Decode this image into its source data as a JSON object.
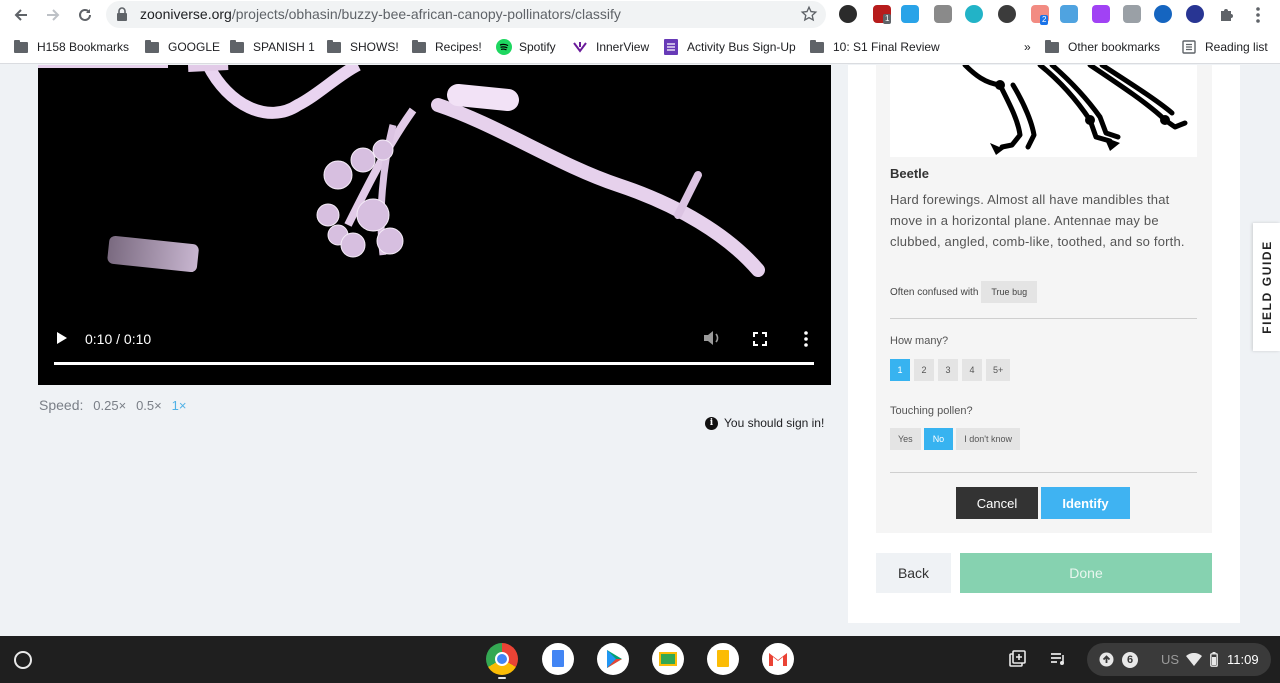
{
  "browser": {
    "url_host": "zooniverse.org",
    "url_path": "/projects/obhasin/buzzy-bee-african-canopy-pollinators/classify",
    "extension_badges": [
      "1",
      "2"
    ]
  },
  "bookmarks": {
    "items": [
      {
        "label": "H158 Bookmarks",
        "icon": "bookmark-folder-icon"
      },
      {
        "label": "GOOGLE",
        "icon": "folder-icon"
      },
      {
        "label": "SPANISH 1",
        "icon": "folder-icon"
      },
      {
        "label": "SHOWS!",
        "icon": "folder-icon"
      },
      {
        "label": "Recipes!",
        "icon": "folder-icon"
      },
      {
        "label": "Spotify",
        "icon": "spotify-icon"
      },
      {
        "label": "InnerView",
        "icon": "innerview-icon"
      },
      {
        "label": "Activity Bus Sign-Up",
        "icon": "forms-icon"
      },
      {
        "label": "10: S1 Final Review",
        "icon": "folder-icon"
      }
    ],
    "overflow": "»",
    "other": "Other bookmarks",
    "reading_list": "Reading list"
  },
  "video": {
    "time": "0:10 / 0:10",
    "progress": 1.0
  },
  "speed": {
    "label": "Speed:",
    "options": [
      "0.25×",
      "0.5×",
      "1×"
    ],
    "selected": "1×"
  },
  "signin": {
    "text": "You should sign in!"
  },
  "field_guide": {
    "tab_label": "FIELD GUIDE"
  },
  "species": {
    "name": "Beetle",
    "description": "Hard forewings. Almost all have mandibles that move in a horizontal plane. Antennae may be clubbed, angled, comb-like, toothed, and so forth.",
    "confused_label": "Often confused with",
    "confused_with": "True bug"
  },
  "questions": {
    "how_many": {
      "label": "How many?",
      "options": [
        "1",
        "2",
        "3",
        "4",
        "5+"
      ],
      "selected": "1"
    },
    "touching_pollen": {
      "label": "Touching pollen?",
      "options": [
        "Yes",
        "No",
        "I don't know"
      ],
      "selected": "No"
    }
  },
  "actions": {
    "cancel": "Cancel",
    "identify": "Identify",
    "back": "Back",
    "done": "Done"
  },
  "taskbar": {
    "notification_count": "6",
    "input_method": "US",
    "clock": "11:09"
  },
  "colors": {
    "accent_blue": "#3fb3f2",
    "done_green": "#86d2b0",
    "cancel_dark": "#333333"
  }
}
